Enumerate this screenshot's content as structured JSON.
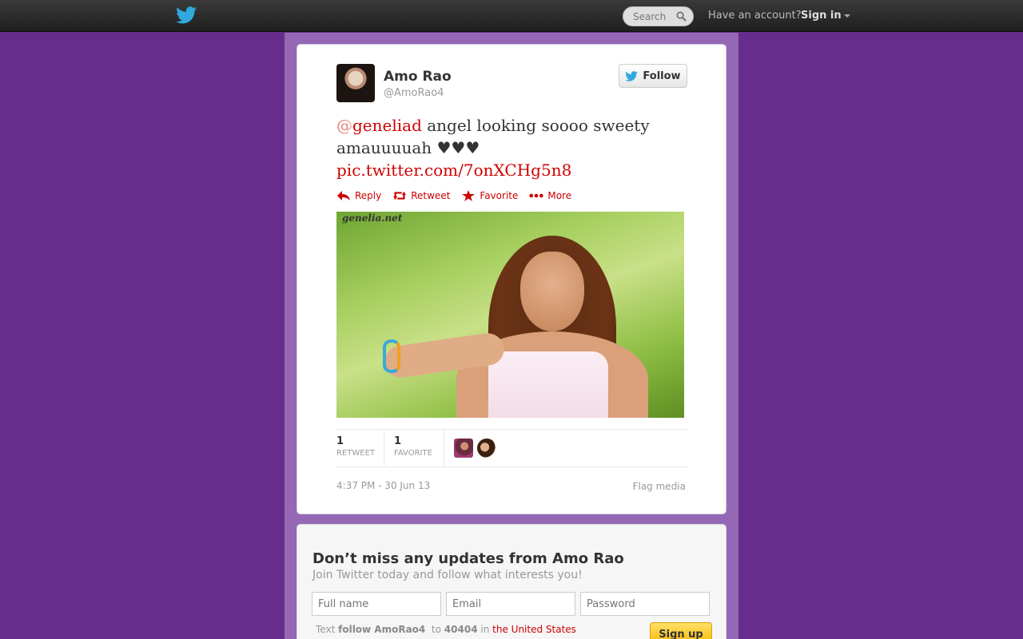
{
  "topbar": {
    "search_placeholder": "Search",
    "have_account": "Have an account?",
    "signin_label": "Sign in"
  },
  "tweet": {
    "user": {
      "name": "Amo Rao",
      "handle": "@AmoRao4"
    },
    "follow_label": "Follow",
    "text": {
      "mention_at": "@",
      "mention": "geneliad",
      "body": " angel looking soooo sweety amauuuuah ♥♥♥",
      "link": "pic.twitter.com/7onXCHg5n8"
    },
    "actions": {
      "reply": "Reply",
      "retweet": "Retweet",
      "favorite": "Favorite",
      "more": "More"
    },
    "media_watermark": "genelia.net",
    "stats": {
      "retweets": "1",
      "retweets_label": "RETWEET",
      "favorites": "1",
      "favorites_label": "FAVORITE"
    },
    "timestamp": "4:37 PM - 30 Jun 13",
    "flag_media": "Flag media"
  },
  "signup": {
    "title": "Don’t miss any updates from Amo Rao",
    "subtitle": "Join Twitter today and follow what interests you!",
    "fullname_placeholder": "Full name",
    "email_placeholder": "Email",
    "password_placeholder": "Password",
    "sms_text": "Text",
    "sms_command": "follow AmoRao4",
    "sms_to": "to",
    "sms_number": "40404",
    "sms_in": "in",
    "sms_country": "the United States",
    "button_label": "Sign up"
  },
  "colors": {
    "background": "#662d8c",
    "column": "#9468b4",
    "link": "#d00000",
    "signup_button": "#f5b800"
  }
}
